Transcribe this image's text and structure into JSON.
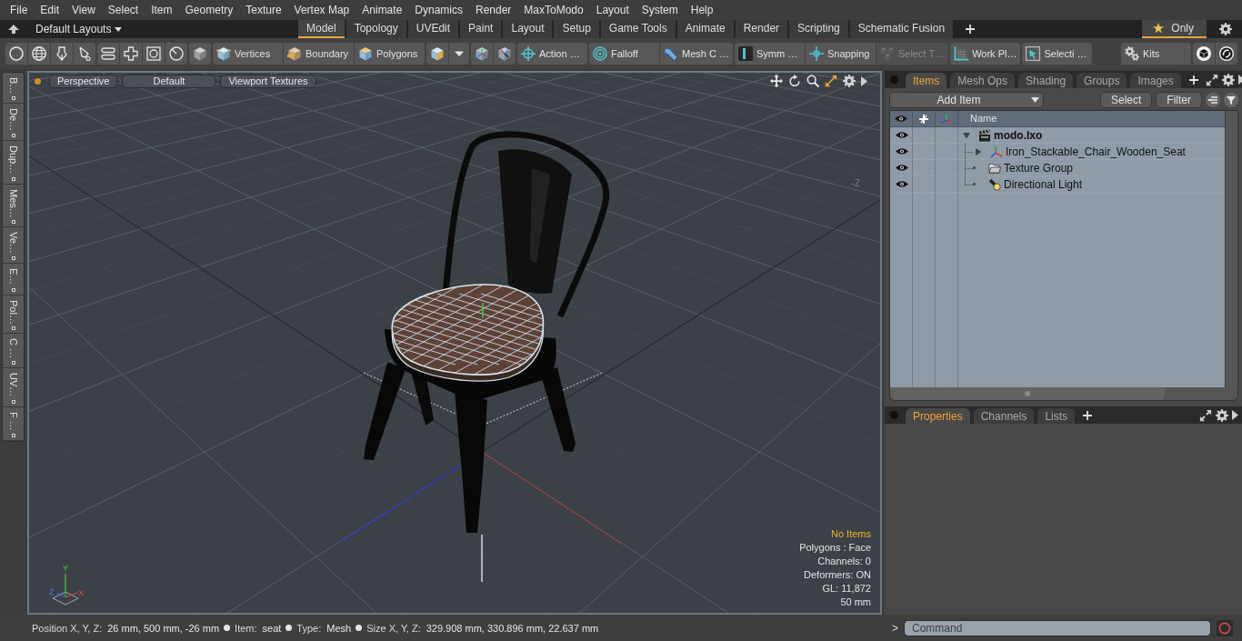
{
  "menu": [
    "File",
    "Edit",
    "View",
    "Select",
    "Item",
    "Geometry",
    "Texture",
    "Vertex Map",
    "Animate",
    "Dynamics",
    "Render",
    "MaxToModo",
    "Layout",
    "System",
    "Help"
  ],
  "layout_bar": {
    "layout_menu": "Default Layouts",
    "tabs": [
      {
        "label": "Model",
        "selected": true
      },
      {
        "label": "Topology",
        "selected": false
      },
      {
        "label": "UVEdit",
        "selected": false
      },
      {
        "label": "Paint",
        "selected": false
      },
      {
        "label": "Layout",
        "selected": false
      },
      {
        "label": "Setup",
        "selected": false
      },
      {
        "label": "Game Tools",
        "selected": false
      },
      {
        "label": "Animate",
        "selected": false
      },
      {
        "label": "Render",
        "selected": false
      },
      {
        "label": "Scripting",
        "selected": false
      },
      {
        "label": "Schematic Fusion",
        "selected": false
      }
    ],
    "favorites": {
      "label": "Only",
      "selected": true
    }
  },
  "toolbar": {
    "left": [
      {
        "buttons": [
          {
            "kind": "icon",
            "disabled": false
          },
          {
            "kind": "icon",
            "disabled": false
          },
          {
            "kind": "icon",
            "disabled": false
          },
          {
            "kind": "icon",
            "disabled": false
          }
        ]
      },
      {
        "buttons": [
          {
            "kind": "icon",
            "disabled": false
          },
          {
            "kind": "icon",
            "disabled": false
          },
          {
            "kind": "icon",
            "disabled": false
          },
          {
            "kind": "icon",
            "disabled": false
          }
        ]
      },
      {
        "buttons": [
          {
            "kind": "icon",
            "disabled": false
          }
        ]
      },
      {
        "buttons": [
          {
            "kind": "labeled",
            "label": "Vertices",
            "disabled": false
          },
          {
            "kind": "labeled",
            "label": "Boundary",
            "disabled": false
          },
          {
            "kind": "labeled",
            "label": "Polygons",
            "disabled": false
          }
        ]
      },
      {
        "buttons": [
          {
            "kind": "icon",
            "disabled": false
          },
          {
            "kind": "dropdown",
            "disabled": false
          }
        ]
      },
      {
        "buttons": [
          {
            "kind": "icon",
            "disabled": false
          },
          {
            "kind": "icon",
            "disabled": false
          }
        ]
      },
      {
        "buttons": [
          {
            "kind": "labeled",
            "label": "Action …",
            "disabled": false
          }
        ]
      },
      {
        "buttons": [
          {
            "kind": "labeled",
            "label": "Falloff",
            "disabled": false
          },
          {
            "kind": "labeled",
            "label": "Mesh C …",
            "disabled": false
          }
        ]
      },
      {
        "buttons": [
          {
            "kind": "labeled",
            "label": "Symm …",
            "disabled": false
          },
          {
            "kind": "labeled",
            "label": "Snapping",
            "disabled": false
          },
          {
            "kind": "labeled",
            "label": "Select T…",
            "disabled": true
          }
        ]
      },
      {
        "buttons": [
          {
            "kind": "labeled",
            "label": "Work Pl…",
            "disabled": false
          }
        ]
      },
      {
        "buttons": [
          {
            "kind": "labeled",
            "label": "Selecti …",
            "disabled": false
          }
        ]
      }
    ],
    "right": [
      {
        "buttons": [
          {
            "kind": "labeled",
            "label": "Kits",
            "disabled": false
          }
        ]
      },
      {
        "buttons": [
          {
            "kind": "icon",
            "disabled": false
          },
          {
            "kind": "icon",
            "disabled": false
          }
        ]
      }
    ]
  },
  "left_tabs": [
    "B…",
    "De…",
    "Dup…",
    "Mes…",
    "Ve…",
    "E…",
    "Pol…",
    "C …",
    "UV…",
    "F …"
  ],
  "viewport": {
    "buttons": [
      "Perspective",
      "Default",
      "Viewport Textures"
    ],
    "axis_label": "-Z",
    "info": [
      {
        "text": "No Items",
        "kind": "notice"
      },
      {
        "text": "Polygons : Face",
        "kind": "stat"
      },
      {
        "text": "Channels: 0",
        "kind": "stat"
      },
      {
        "text": "Deformers: ON",
        "kind": "stat"
      },
      {
        "text": "GL: 11,872",
        "kind": "stat"
      },
      {
        "text": "50 mm",
        "kind": "stat"
      }
    ],
    "gizmo": {
      "x": "X",
      "y": "Y",
      "z": "Z"
    }
  },
  "items_panel": {
    "tabs": [
      {
        "label": "Items",
        "selected": true
      },
      {
        "label": "Mesh Ops",
        "selected": false
      },
      {
        "label": "Shading",
        "selected": false
      },
      {
        "label": "Groups",
        "selected": false
      },
      {
        "label": "Images",
        "selected": false
      }
    ],
    "add_item": "Add Item",
    "buttons": [
      "Select",
      "Filter"
    ],
    "name_column": "Name",
    "tree": [
      {
        "label": "modo.lxo",
        "kind": "scene",
        "visible": true,
        "expanded": true,
        "children": [
          {
            "label": "Iron_Stackable_Chair_Wooden_Seat",
            "kind": "mesh",
            "visible": true,
            "expanded": false
          },
          {
            "label": "Texture Group",
            "kind": "group",
            "visible": true
          },
          {
            "label": "Directional Light",
            "kind": "light",
            "visible": true
          }
        ]
      }
    ]
  },
  "properties_panel": {
    "tabs": [
      {
        "label": "Properties",
        "selected": true
      },
      {
        "label": "Channels",
        "selected": false
      },
      {
        "label": "Lists",
        "selected": false
      }
    ]
  },
  "status_bar": {
    "fields": [
      {
        "label": "Position X, Y, Z:",
        "value": "26 mm, 500 mm, -26 mm"
      },
      {
        "label": "Item:",
        "value": "seat"
      },
      {
        "label": "Type:",
        "value": "Mesh"
      },
      {
        "label": "Size X, Y, Z:",
        "value": "329.908 mm, 330.896 mm, 22.637 mm"
      }
    ]
  },
  "command": {
    "prompt": ">",
    "placeholder": "Command"
  }
}
